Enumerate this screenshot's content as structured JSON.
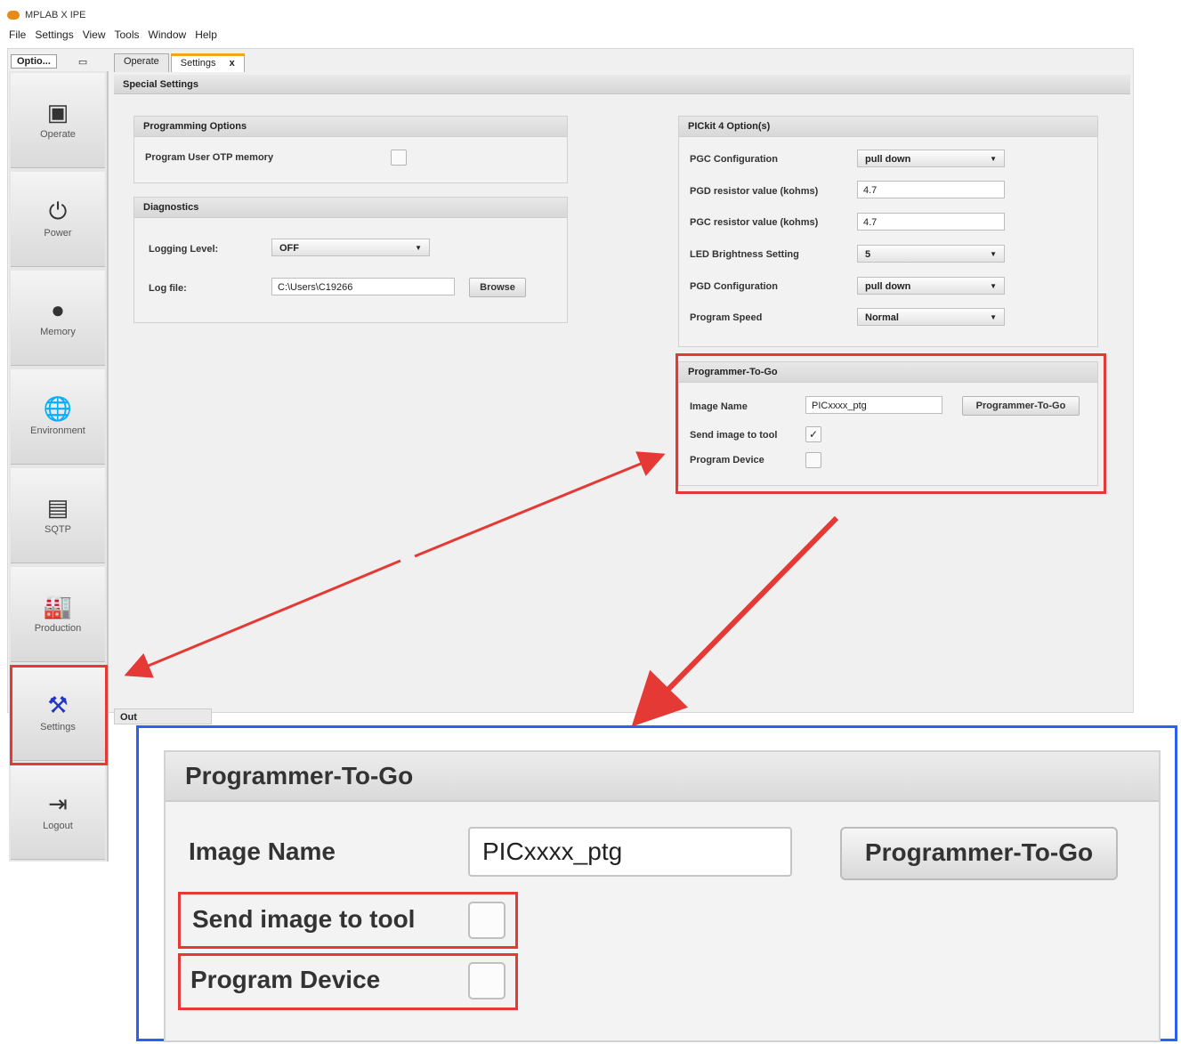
{
  "window": {
    "title": "MPLAB X IPE"
  },
  "menu": [
    "File",
    "Settings",
    "View",
    "Tools",
    "Window",
    "Help"
  ],
  "sidebar": {
    "tab_label": "Optio...",
    "items": [
      {
        "label": "Operate",
        "icon": "operate-icon",
        "glyph": "▣"
      },
      {
        "label": "Power",
        "icon": "power-plug-icon",
        "glyph": "⏻"
      },
      {
        "label": "Memory",
        "icon": "memory-chip-icon",
        "glyph": "●"
      },
      {
        "label": "Environment",
        "icon": "globe-icon",
        "glyph": "🌐"
      },
      {
        "label": "SQTP",
        "icon": "sqtp-icon",
        "glyph": "▤"
      },
      {
        "label": "Production",
        "icon": "factory-icon",
        "glyph": "🏭"
      },
      {
        "label": "Settings",
        "icon": "tools-icon",
        "glyph": "⚒"
      },
      {
        "label": "Logout",
        "icon": "logout-icon",
        "glyph": "⇥"
      }
    ]
  },
  "tabs": [
    {
      "label": "Operate",
      "active": false
    },
    {
      "label": "Settings",
      "active": true,
      "close": "x"
    }
  ],
  "section_title": "Special Settings",
  "programming_options": {
    "title": "Programming Options",
    "program_user_otp_label": "Program User OTP memory",
    "program_user_otp_checked": false
  },
  "diagnostics": {
    "title": "Diagnostics",
    "logging_level_label": "Logging Level:",
    "logging_level_value": "OFF",
    "log_file_label": "Log file:",
    "log_file_value": "C:\\Users\\C19266",
    "browse_label": "Browse"
  },
  "pickit_options": {
    "title": "PICkit 4 Option(s)",
    "rows": [
      {
        "label": "PGC Configuration",
        "value": "pull down",
        "kind": "select"
      },
      {
        "label": "PGD resistor value (kohms)",
        "value": "4.7",
        "kind": "input"
      },
      {
        "label": "PGC resistor value (kohms)",
        "value": "4.7",
        "kind": "input"
      },
      {
        "label": "LED Brightness Setting",
        "value": "5",
        "kind": "select"
      },
      {
        "label": "PGD Configuration",
        "value": "pull down",
        "kind": "select"
      },
      {
        "label": "Program Speed",
        "value": "Normal",
        "kind": "select"
      }
    ]
  },
  "ptg_small": {
    "title": "Programmer-To-Go",
    "image_name_label": "Image Name",
    "image_name_value": "PICxxxx_ptg",
    "button_label": "Programmer-To-Go",
    "send_image_label": "Send image to tool",
    "send_image_checked": true,
    "program_device_label": "Program Device",
    "program_device_checked": false
  },
  "output_tab": "Out",
  "ptg_zoom": {
    "title": "Programmer-To-Go",
    "image_name_label": "Image Name",
    "image_name_value": "PICxxxx_ptg",
    "button_label": "Programmer-To-Go",
    "send_image_label": "Send image to tool",
    "program_device_label": "Program Device"
  },
  "colors": {
    "highlight_red": "#e53935",
    "zoom_blue": "#2f5ff0",
    "active_tab": "#f2a41b"
  }
}
